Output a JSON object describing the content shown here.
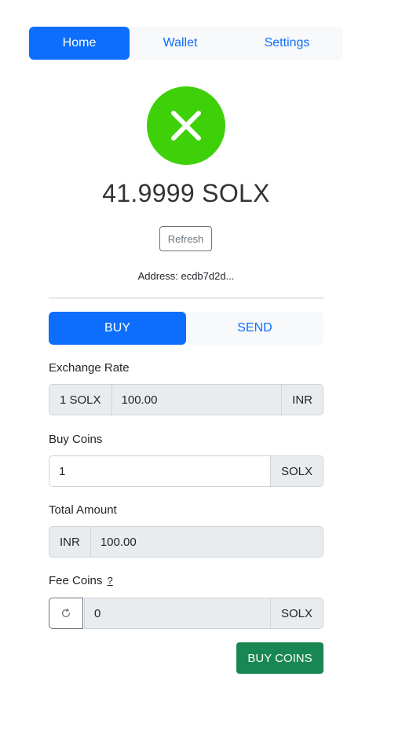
{
  "nav": {
    "tabs": [
      {
        "label": "Home",
        "active": true
      },
      {
        "label": "Wallet",
        "active": false
      },
      {
        "label": "Settings",
        "active": false
      }
    ]
  },
  "wallet": {
    "logo_icon": "close-icon",
    "logo_color": "#3ed10a",
    "balance": "41.9999 SOLX",
    "refresh_label": "Refresh",
    "address": "Address: ecdb7d2d..."
  },
  "trade_tabs": [
    {
      "label": "BUY",
      "active": true
    },
    {
      "label": "SEND",
      "active": false
    }
  ],
  "form": {
    "exchange_rate": {
      "label": "Exchange Rate",
      "prefix": "1 SOLX",
      "value": "100.00",
      "suffix": "INR"
    },
    "buy_coins": {
      "label": "Buy Coins",
      "value": "1",
      "suffix": "SOLX"
    },
    "total_amount": {
      "label": "Total Amount",
      "prefix": "INR",
      "value": "100.00"
    },
    "fee_coins": {
      "label": "Fee Coins",
      "help": "?",
      "refresh_icon": "refresh-icon",
      "value": "0",
      "suffix": "SOLX"
    },
    "submit_label": "BUY COINS"
  },
  "colors": {
    "primary": "#0d6efd",
    "success": "#198754"
  }
}
